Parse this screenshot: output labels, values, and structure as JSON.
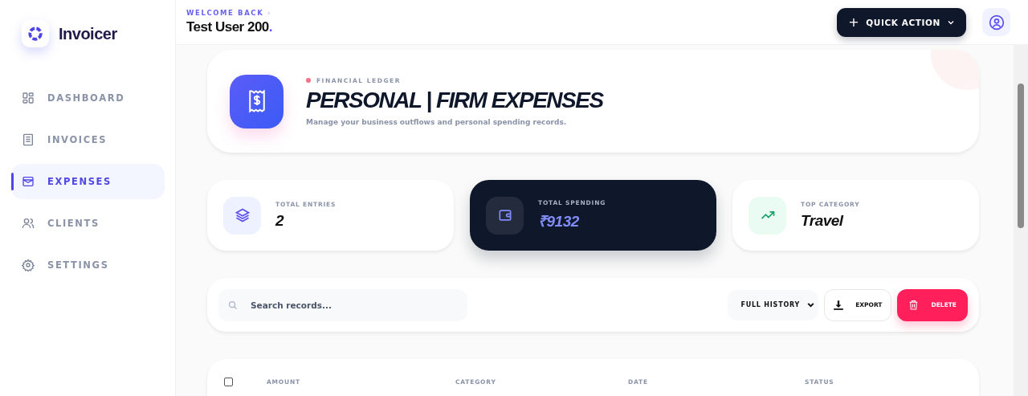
{
  "brand": {
    "name": "Invoicer"
  },
  "sidebar": {
    "items": [
      {
        "label": "DASHBOARD",
        "kind": "grid",
        "selected": false
      },
      {
        "label": "INVOICES",
        "kind": "doc",
        "selected": false
      },
      {
        "label": "EXPENSES",
        "kind": "wallet",
        "selected": true
      },
      {
        "label": "CLIENTS",
        "kind": "users",
        "selected": false
      },
      {
        "label": "SETTINGS",
        "kind": "gear",
        "selected": false
      }
    ]
  },
  "header": {
    "greeting": "WELCOME BACK",
    "chevron": "›",
    "user": "Test User 200",
    "user_dot": ".",
    "quick_action": {
      "plus": "+",
      "label": "QUICK ACTION"
    }
  },
  "hero": {
    "eyebrow": "FINANCIAL LEDGER",
    "title": "PERSONAL | FIRM EXPENSES",
    "subtitle": "Manage your business outflows and personal spending records."
  },
  "stats": [
    {
      "label": "TOTAL ENTRIES",
      "value": "2",
      "kind": "layers",
      "dark": false
    },
    {
      "label": "TOTAL SPENDING",
      "value": "₹9132",
      "kind": "wallet",
      "dark": true
    },
    {
      "label": "TOP CATEGORY",
      "value": "Travel",
      "kind": "trend",
      "dark": false
    }
  ],
  "toolbar": {
    "search": {
      "placeholder": "Search records..."
    },
    "filter": "FULL HISTORY",
    "export": "EXPORT",
    "delete": "DELETE"
  },
  "table": {
    "select_all": {
      "checked": false
    },
    "columns": [
      "AMOUNT",
      "CATEGORY",
      "DATE",
      "STATUS"
    ]
  }
}
